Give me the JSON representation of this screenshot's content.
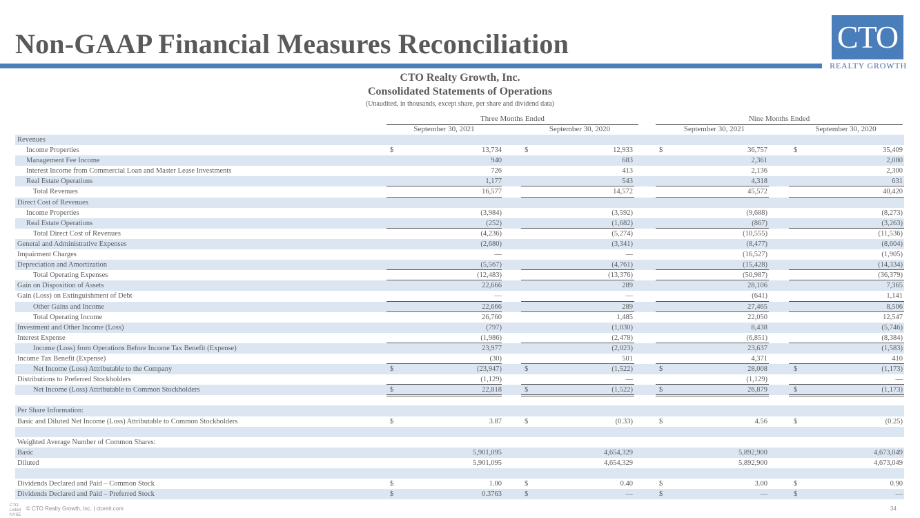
{
  "page": {
    "title": "Non-GAAP Financial Measures Reconciliation",
    "logo_text": "CTO",
    "logo_subtext": "REALTY GROWTH",
    "company": "CTO Realty Growth, Inc.",
    "statement": "Consolidated Statements of Operations",
    "note": "(Unaudited, in thousands, except share, per share and dividend data)",
    "footer": "© CTO Realty Growth, Inc. | ctoreit.com",
    "page_number": "34",
    "nyse_label": "CTO\nListed\nNYSE"
  },
  "columns": {
    "groups": [
      "Three Months Ended",
      "Nine Months Ended"
    ],
    "periods": [
      "September 30, 2021",
      "September 30, 2020",
      "September 30, 2021",
      "September 30, 2020"
    ]
  },
  "colors": {
    "accent": "#4a7ebb",
    "row_shade": "#dce6f2",
    "text": "#595959"
  },
  "rows": [
    {
      "label": "Revenues",
      "indent": 0,
      "values": [
        "",
        "",
        "",
        ""
      ]
    },
    {
      "label": "Income Properties",
      "indent": 1,
      "dollar": true,
      "values": [
        "13,734",
        "12,933",
        "36,757",
        "35,409"
      ]
    },
    {
      "label": "Management Fee Income",
      "indent": 1,
      "values": [
        "940",
        "683",
        "2,361",
        "2,080"
      ]
    },
    {
      "label": "Interest Income from Commercial Loan and Master Lease Investments",
      "indent": 1,
      "values": [
        "726",
        "413",
        "2,136",
        "2,300"
      ]
    },
    {
      "label": "Real Estate Operations",
      "indent": 1,
      "underline": true,
      "values": [
        "1,177",
        "543",
        "4,318",
        "631"
      ]
    },
    {
      "label": "Total Revenues",
      "indent": 2,
      "underline": true,
      "values": [
        "16,577",
        "14,572",
        "45,572",
        "40,420"
      ]
    },
    {
      "label": "Direct Cost of Revenues",
      "indent": 0,
      "values": [
        "",
        "",
        "",
        ""
      ]
    },
    {
      "label": "Income Properties",
      "indent": 1,
      "values": [
        "(3,984)",
        "(3,592)",
        "(9,688)",
        "(8,273)"
      ]
    },
    {
      "label": "Real Estate Operations",
      "indent": 1,
      "underline": true,
      "values": [
        "(252)",
        "(1,682)",
        "(867)",
        "(3,263)"
      ]
    },
    {
      "label": "Total Direct Cost of Revenues",
      "indent": 2,
      "values": [
        "(4,236)",
        "(5,274)",
        "(10,555)",
        "(11,536)"
      ]
    },
    {
      "label": "General and Administrative Expenses",
      "indent": 0,
      "values": [
        "(2,680)",
        "(3,341)",
        "(8,477)",
        "(8,604)"
      ]
    },
    {
      "label": "Impairment Charges",
      "indent": 0,
      "values": [
        "—",
        "—",
        "(16,527)",
        "(1,905)"
      ]
    },
    {
      "label": "Depreciation and Amortization",
      "indent": 0,
      "underline": true,
      "values": [
        "(5,567)",
        "(4,761)",
        "(15,428)",
        "(14,334)"
      ]
    },
    {
      "label": "Total Operating Expenses",
      "indent": 2,
      "underline": true,
      "values": [
        "(12,483)",
        "(13,376)",
        "(50,987)",
        "(36,379)"
      ]
    },
    {
      "label": "Gain on Disposition of Assets",
      "indent": 0,
      "values": [
        "22,666",
        "289",
        "28,106",
        "7,365"
      ]
    },
    {
      "label": "Gain (Loss) on Extinguishment of Debt",
      "indent": 0,
      "underline": true,
      "values": [
        "—",
        "—",
        "(641)",
        "1,141"
      ]
    },
    {
      "label": "Other Gains and Income",
      "indent": 2,
      "underline": true,
      "values": [
        "22,666",
        "289",
        "27,465",
        "8,506"
      ]
    },
    {
      "label": "Total Operating Income",
      "indent": 2,
      "values": [
        "26,760",
        "1,485",
        "22,050",
        "12,547"
      ]
    },
    {
      "label": "Investment and Other Income (Loss)",
      "indent": 0,
      "values": [
        "(797)",
        "(1,030)",
        "8,438",
        "(5,746)"
      ]
    },
    {
      "label": "Interest Expense",
      "indent": 0,
      "underline": true,
      "values": [
        "(1,986)",
        "(2,478)",
        "(6,851)",
        "(8,384)"
      ]
    },
    {
      "label": "Income (Loss) from Operations Before Income Tax Benefit (Expense)",
      "indent": 2,
      "values": [
        "23,977",
        "(2,023)",
        "23,637",
        "(1,583)"
      ]
    },
    {
      "label": "Income Tax Benefit (Expense)",
      "indent": 0,
      "underline": true,
      "values": [
        "(30)",
        "501",
        "4,371",
        "410"
      ]
    },
    {
      "label": "Net Income (Loss) Attributable to the Company",
      "indent": 2,
      "dollar": true,
      "values": [
        "(23,947)",
        "(1,522)",
        "28,008",
        "(1,173)"
      ]
    },
    {
      "label": "Distributions to Preferred Stockholders",
      "indent": 0,
      "underline": true,
      "values": [
        "(1,129)",
        "—",
        "(1,129)",
        "—"
      ]
    },
    {
      "label": "Net Income (Loss) Attributable to Common Stockholders",
      "indent": 2,
      "dollar": true,
      "double": true,
      "values": [
        "22,818",
        "(1,522)",
        "26,879",
        "(1,173)"
      ]
    },
    {
      "label": "",
      "indent": 0,
      "values": [
        "",
        "",
        "",
        ""
      ]
    },
    {
      "label": "Per Share Information:",
      "indent": 0,
      "values": [
        "",
        "",
        "",
        ""
      ]
    },
    {
      "label": "Basic and Diluted Net Income (Loss) Attributable to Common Stockholders",
      "indent": 0,
      "dollar": true,
      "values": [
        "3.87",
        "(0.33)",
        "4.56",
        "(0.25)"
      ]
    },
    {
      "label": "",
      "indent": 0,
      "values": [
        "",
        "",
        "",
        ""
      ]
    },
    {
      "label": "Weighted Average Number of Common Shares:",
      "indent": 0,
      "values": [
        "",
        "",
        "",
        ""
      ]
    },
    {
      "label": "Basic",
      "indent": 0,
      "values": [
        "5,901,095",
        "4,654,329",
        "5,892,900",
        "4,673,049"
      ]
    },
    {
      "label": "Diluted",
      "indent": 0,
      "values": [
        "5,901,095",
        "4,654,329",
        "5,892,900",
        "4,673,049"
      ]
    },
    {
      "label": "",
      "indent": 0,
      "values": [
        "",
        "",
        "",
        ""
      ]
    },
    {
      "label": "Dividends Declared and Paid – Common Stock",
      "indent": 0,
      "dollar": true,
      "values": [
        "1.00",
        "0.40",
        "3.00",
        "0.90"
      ]
    },
    {
      "label": "Dividends Declared and Paid – Preferred Stock",
      "indent": 0,
      "dollar": true,
      "values": [
        "0.3763",
        "—",
        "—",
        "—"
      ]
    }
  ]
}
